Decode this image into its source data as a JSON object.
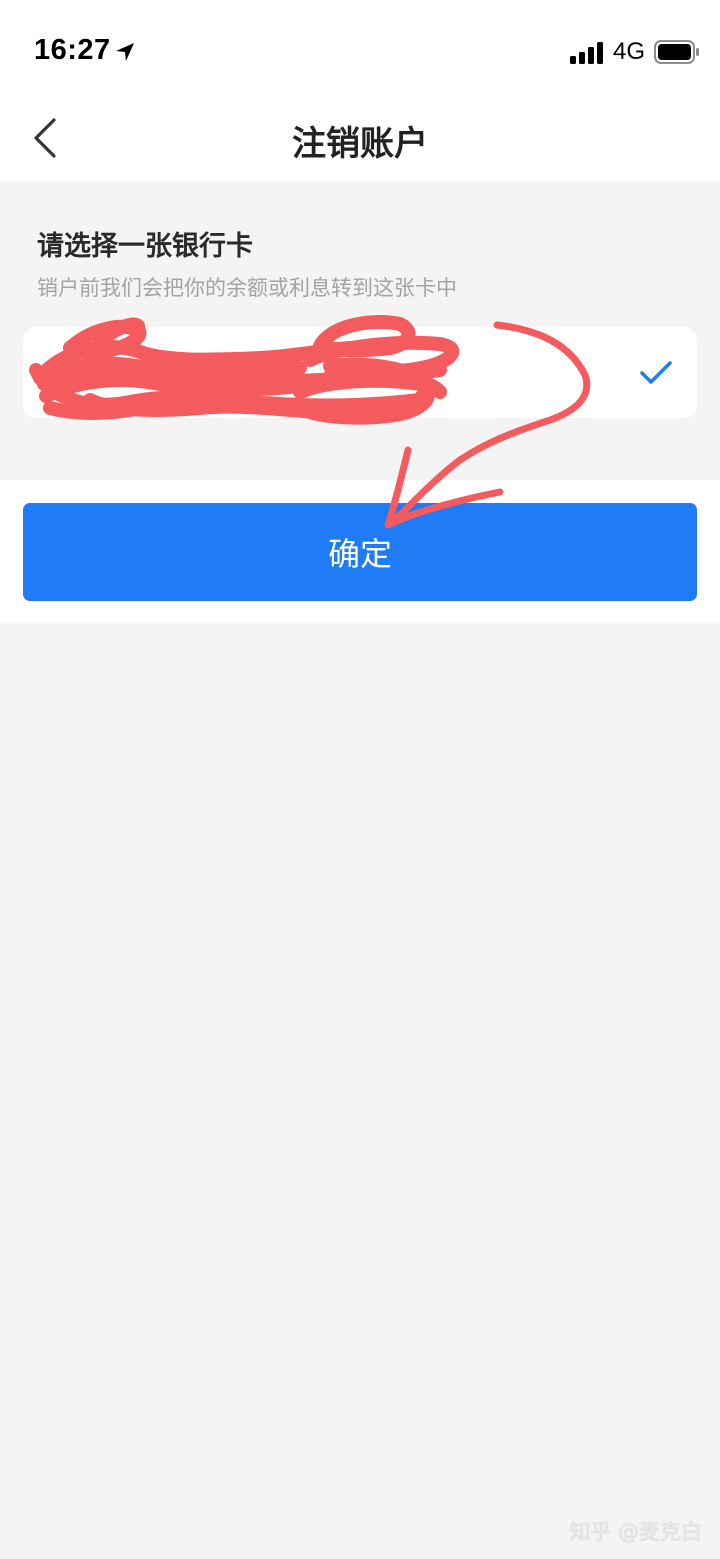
{
  "status_bar": {
    "time": "16:27",
    "network": "4G",
    "icons": [
      "location-arrow-icon",
      "signal-bars-icon",
      "battery-icon"
    ]
  },
  "nav": {
    "title": "注销账户",
    "back_icon": "chevron-left-icon"
  },
  "section": {
    "title": "请选择一张银行卡",
    "subtitle": "销户前我们会把你的余额或利息转到这张卡中"
  },
  "bank_card": {
    "selected": true,
    "check_icon": "checkmark-icon",
    "check_color": "#1f7bf6"
  },
  "confirm_button": {
    "label": "确定",
    "color": "#1f7bf6"
  },
  "annotation": {
    "color": "#f45b5e",
    "shapes": [
      "redaction-scribble",
      "arrow-to-confirm"
    ]
  },
  "watermark": "知乎 @麦克白"
}
